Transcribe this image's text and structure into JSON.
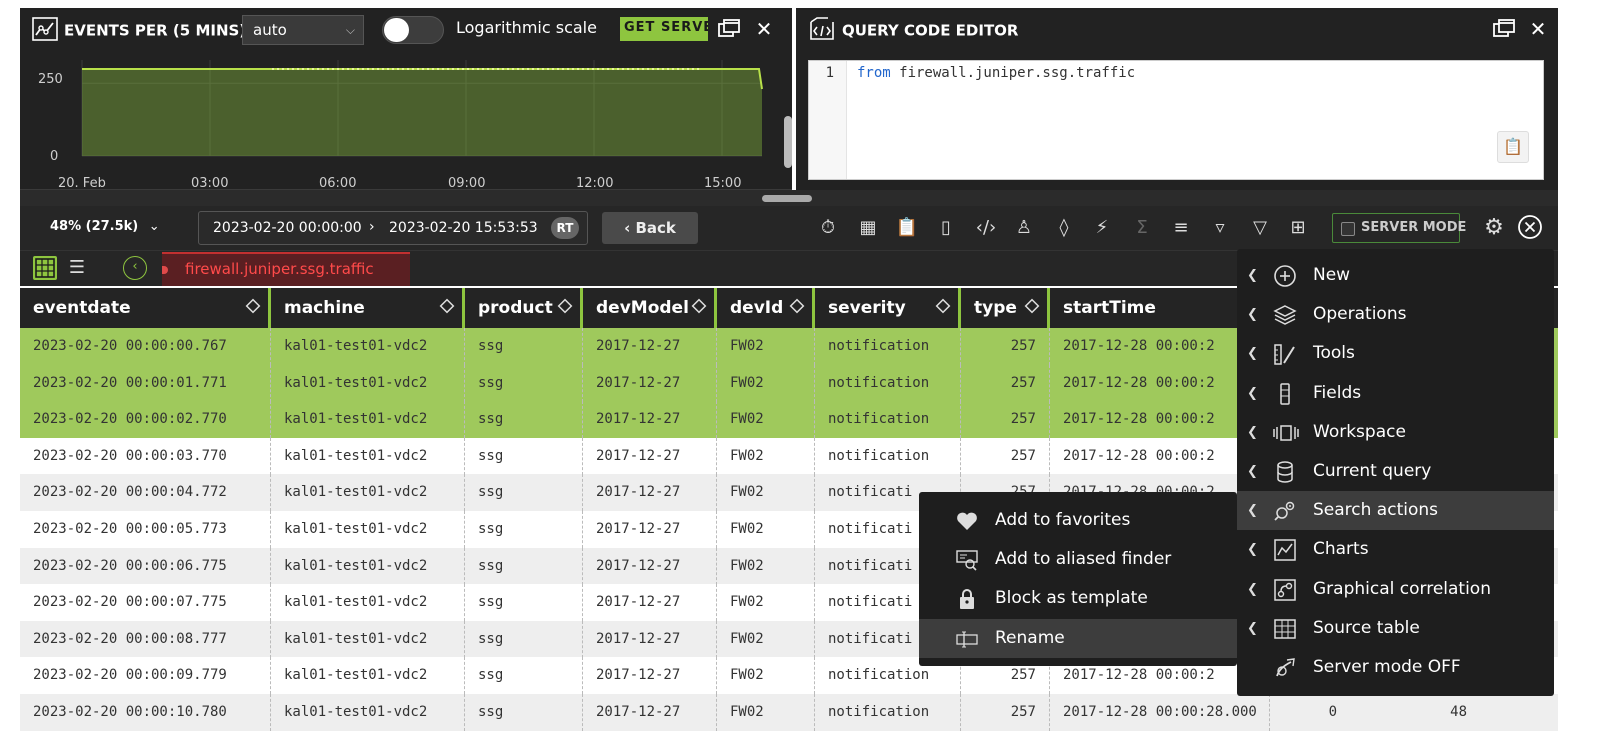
{
  "chart_panel": {
    "title": "EVENTS PER (5 MINS)",
    "interval": "auto",
    "log_scale_label": "Logarithmic scale",
    "log_scale_on": false,
    "get_server_label": "GET SERVE",
    "accent": "#8ec53f"
  },
  "chart_data": {
    "type": "area",
    "x": [
      "00:00",
      "00:05",
      "00:10",
      "00:15",
      "00:20",
      "00:25",
      "00:30",
      "15:30",
      "15:35",
      "15:40",
      "15:45",
      "15:50",
      "15:55"
    ],
    "y_level": 299,
    "series": [
      {
        "values": [
          299,
          299,
          299,
          299,
          299,
          299,
          299,
          299,
          299,
          299,
          299,
          299,
          299
        ]
      }
    ],
    "yticks": [
      "0",
      "250"
    ],
    "xticks": [
      "20. Feb",
      "03:00",
      "06:00",
      "09:00",
      "12:00",
      "15:00"
    ],
    "ylim": [
      0,
      330
    ],
    "grid": true,
    "legend": "none"
  },
  "editor": {
    "title": "QUERY CODE EDITOR",
    "line_number": "1",
    "keyword": "from",
    "code_rest": " firewall.juniper.ssg.traffic"
  },
  "toolbar": {
    "percent": "48% (27.5k)",
    "date_from": "2023-02-20 00:00:00",
    "date_to": "2023-02-20 15:53:53",
    "rt": "RT",
    "back": "Back",
    "server_mode": "SERVER MODE"
  },
  "tab": {
    "name": "firewall.juniper.ssg.traffic"
  },
  "grid": {
    "columns": [
      "eventdate",
      "machine",
      "product",
      "devModel",
      "devId",
      "severity",
      "type",
      "startTime"
    ],
    "rows": [
      [
        "2023-02-20 00:00:00.767",
        "kal01-test01-vdc2",
        "ssg",
        "2017-12-27",
        "FW02",
        "notification",
        "257",
        "2017-12-28 00:00:2"
      ],
      [
        "2023-02-20 00:00:01.771",
        "kal01-test01-vdc2",
        "ssg",
        "2017-12-27",
        "FW02",
        "notification",
        "257",
        "2017-12-28 00:00:2"
      ],
      [
        "2023-02-20 00:00:02.770",
        "kal01-test01-vdc2",
        "ssg",
        "2017-12-27",
        "FW02",
        "notification",
        "257",
        "2017-12-28 00:00:2"
      ],
      [
        "2023-02-20 00:00:03.770",
        "kal01-test01-vdc2",
        "ssg",
        "2017-12-27",
        "FW02",
        "notification",
        "257",
        "2017-12-28 00:00:2"
      ],
      [
        "2023-02-20 00:00:04.772",
        "kal01-test01-vdc2",
        "ssg",
        "2017-12-27",
        "FW02",
        "notificati",
        "257",
        "2017-12-28 00:00:2"
      ],
      [
        "2023-02-20 00:00:05.773",
        "kal01-test01-vdc2",
        "ssg",
        "2017-12-27",
        "FW02",
        "notificati",
        "",
        ""
      ],
      [
        "2023-02-20 00:00:06.775",
        "kal01-test01-vdc2",
        "ssg",
        "2017-12-27",
        "FW02",
        "notificati",
        "",
        ""
      ],
      [
        "2023-02-20 00:00:07.775",
        "kal01-test01-vdc2",
        "ssg",
        "2017-12-27",
        "FW02",
        "notificati",
        "",
        ""
      ],
      [
        "2023-02-20 00:00:08.777",
        "kal01-test01-vdc2",
        "ssg",
        "2017-12-27",
        "FW02",
        "notificati",
        "",
        ""
      ],
      [
        "2023-02-20 00:00:09.779",
        "kal01-test01-vdc2",
        "ssg",
        "2017-12-27",
        "FW02",
        "notification",
        "257",
        "2017-12-28 00:00:2"
      ],
      [
        "2023-02-20 00:00:10.780",
        "kal01-test01-vdc2",
        "ssg",
        "2017-12-27",
        "FW02",
        "notification",
        "257",
        "2017-12-28 00:00:28.000"
      ]
    ],
    "extra_last_row": [
      "0",
      "48"
    ],
    "selected_rows": 3
  },
  "main_menu": {
    "items": [
      {
        "label": "New",
        "icon": "plus-circle-icon",
        "arrow": true
      },
      {
        "label": "Operations",
        "icon": "layers-icon",
        "arrow": true
      },
      {
        "label": "Tools",
        "icon": "ruler-pencil-icon",
        "arrow": true
      },
      {
        "label": "Fields",
        "icon": "columns-icon",
        "arrow": true
      },
      {
        "label": "Workspace",
        "icon": "workspace-icon",
        "arrow": true
      },
      {
        "label": "Current query",
        "icon": "database-icon",
        "arrow": true
      },
      {
        "label": "Search actions",
        "icon": "search-gear-icon",
        "arrow": true,
        "highlighted": true
      },
      {
        "label": "Charts",
        "icon": "chart-icon",
        "arrow": true
      },
      {
        "label": "Graphical correlation",
        "icon": "correlation-icon",
        "arrow": true
      },
      {
        "label": "Source table",
        "icon": "table-icon",
        "arrow": true
      },
      {
        "label": "Server mode OFF",
        "icon": "server-mode-icon",
        "arrow": false
      }
    ]
  },
  "sub_menu": {
    "items": [
      {
        "label": "Add to favorites",
        "icon": "heart-icon"
      },
      {
        "label": "Add to aliased finder",
        "icon": "finder-icon"
      },
      {
        "label": "Block as template",
        "icon": "lock-icon"
      },
      {
        "label": "Rename",
        "icon": "rename-icon",
        "highlighted": true
      }
    ]
  }
}
